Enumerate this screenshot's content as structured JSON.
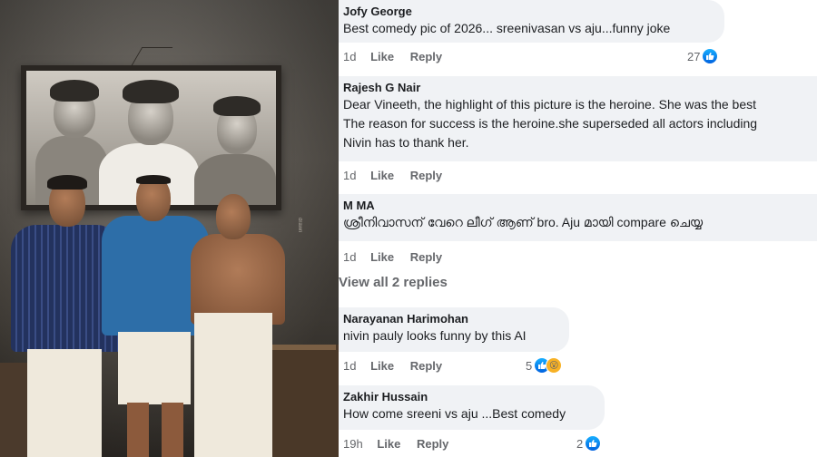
{
  "poster": {
    "watermark": "drawn",
    "colors": {
      "blue_shirt": "#2d6ea8",
      "striped_shirt": "#23325e",
      "mundu": "#efe9dc"
    }
  },
  "comments": [
    {
      "author": "Jofy George",
      "lines": [
        "Best comedy pic of 2026... sreenivasan vs aju...funny joke"
      ],
      "time": "1d",
      "like": "Like",
      "reply": "Reply",
      "reaction_count": "27",
      "reactions": [
        "like-icon"
      ]
    },
    {
      "author": "Rajesh G Nair",
      "lines": [
        "Dear Vineeth, the highlight of this picture is the heroine. She was the best",
        "The reason for success is the heroine.she superseded all actors including",
        "Nivin has to thank her."
      ],
      "time": "1d",
      "like": "Like",
      "reply": "Reply",
      "reaction_count": "",
      "reactions": []
    },
    {
      "author": "M MA",
      "lines": [
        "ശ്രീനിവാസന് വേറെ ലീഗ് ആണ് bro. Aju മായി compare ചെയ്യ"
      ],
      "time": "1d",
      "like": "Like",
      "reply": "Reply",
      "reaction_count": "",
      "reactions": []
    },
    {
      "author": "Narayanan Harimohan",
      "lines": [
        "nivin pauly looks funny by this AI"
      ],
      "time": "1d",
      "like": "Like",
      "reply": "Reply",
      "reaction_count": "5",
      "reactions": [
        "like-icon",
        "wow-icon"
      ]
    },
    {
      "author": "Zakhir Hussain",
      "lines": [
        "How come sreeni vs aju ...Best comedy"
      ],
      "time": "19h",
      "like": "Like",
      "reply": "Reply",
      "reaction_count": "2",
      "reactions": [
        "like-icon"
      ]
    }
  ],
  "view_replies": "View all 2 replies"
}
